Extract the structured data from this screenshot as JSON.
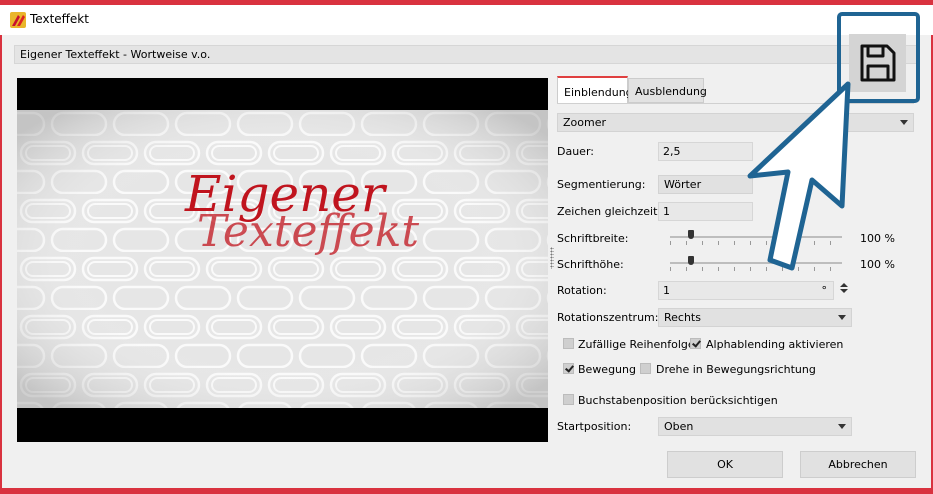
{
  "window": {
    "title": "Texteffekt"
  },
  "subtitle": "Eigener Texteffekt - Wortweise v.o.",
  "preview": {
    "text_line1": "Eigener",
    "text_line2": "Texteffekt"
  },
  "tabs": [
    {
      "label": "Einblendung",
      "active": true
    },
    {
      "label": "Ausblendung",
      "active": false
    }
  ],
  "effect_select": {
    "value": "Zoomer"
  },
  "fields": {
    "dauer": {
      "label": "Dauer:",
      "value": "2,5"
    },
    "segmentierung": {
      "label": "Segmentierung:",
      "value": "Wörter"
    },
    "zeichen": {
      "label": "Zeichen gleichzeitig:",
      "value": "1"
    },
    "schriftbreite": {
      "label": "Schriftbreite:",
      "value": "100 %",
      "level": 0.12
    },
    "schrifthoehe": {
      "label": "Schrifthöhe:",
      "value": "100 %",
      "level": 0.12
    },
    "rotation": {
      "label": "Rotation:",
      "value": "1",
      "unit": "°"
    },
    "rotationszentrum": {
      "label": "Rotationszentrum:",
      "value": "Rechts"
    },
    "startposition": {
      "label": "Startposition:",
      "value": "Oben"
    }
  },
  "checkboxes": {
    "zufaellig": {
      "label": "Zufällige Reihenfolge",
      "checked": false
    },
    "alphablending": {
      "label": "Alphablending aktivieren",
      "checked": true
    },
    "bewegung": {
      "label": "Bewegung",
      "checked": true
    },
    "drehe": {
      "label": "Drehe in Bewegungsrichtung",
      "checked": false
    },
    "buchstabenposition": {
      "label": "Buchstabenposition berücksichtigen",
      "checked": false
    }
  },
  "buttons": {
    "ok": "OK",
    "cancel": "Abbrechen"
  },
  "icons": {
    "save": "save-icon",
    "app": "app-icon"
  },
  "colors": {
    "accent": "#d9323f",
    "highlight": "#1f6493",
    "preview_text": "#c0141e"
  }
}
